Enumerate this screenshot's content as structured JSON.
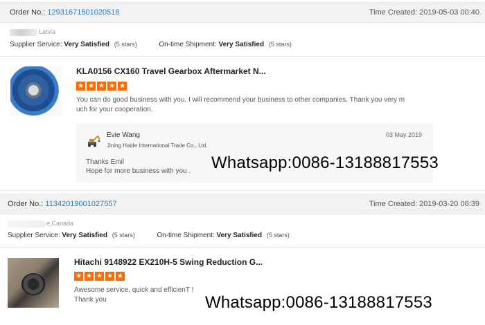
{
  "reviews": [
    {
      "order_label": "Order No.: ",
      "order_no": "12931671501020518",
      "time_created": "Time Created: 2019-05-03 00:40",
      "buyer_country": "Latvia",
      "supplier_service_label": "Supplier Service:",
      "supplier_service_value": "Very Satisfied",
      "supplier_service_stars": "(5 stars)",
      "shipment_label": "On-time Shipment:",
      "shipment_value": "Very Satisfied",
      "shipment_stars": "(5 stars)",
      "product_title": "KLA0156 CX160 Travel Gearbox Aftermarket N...",
      "rating": 5,
      "comment_line1": "You can do good business with you. I will recommend your business to other companies. Thank you very m",
      "comment_line2": "uch for your cooperation.",
      "reply": {
        "name": "Evie Wang",
        "company": "Jining Haide International Trade Co., Ltd.",
        "date": "03 May 2019",
        "line1": "Thanks Emil",
        "line2": "Hope for more business with you ."
      },
      "watermark": "Whatsapp:0086-13188817553"
    },
    {
      "order_label": "Order No.: ",
      "order_no": "11342019001027557",
      "time_created": "Time Created: 2019-03-20 06:39",
      "buyer_country": "e,Canada",
      "supplier_service_label": "Supplier Service:",
      "supplier_service_value": "Very Satisfied",
      "supplier_service_stars": "(5 stars)",
      "shipment_label": "On-time Shipment:",
      "shipment_value": "Very Satisfied",
      "shipment_stars": "(5 stars)",
      "product_title": "Hitachi 9148922 EX210H-5 Swing Reduction G...",
      "rating": 5,
      "comment_line1": "Awesome service, quick and efficienT !",
      "comment_line2": "Thank you",
      "watermark": "Whatsapp:0086-13188817553"
    }
  ],
  "colors": {
    "star": "#ff6a00",
    "link": "#2a7ab8",
    "bar": "#f2f2f2"
  },
  "icons": {
    "star": "star-icon",
    "excavator": "excavator-icon"
  }
}
